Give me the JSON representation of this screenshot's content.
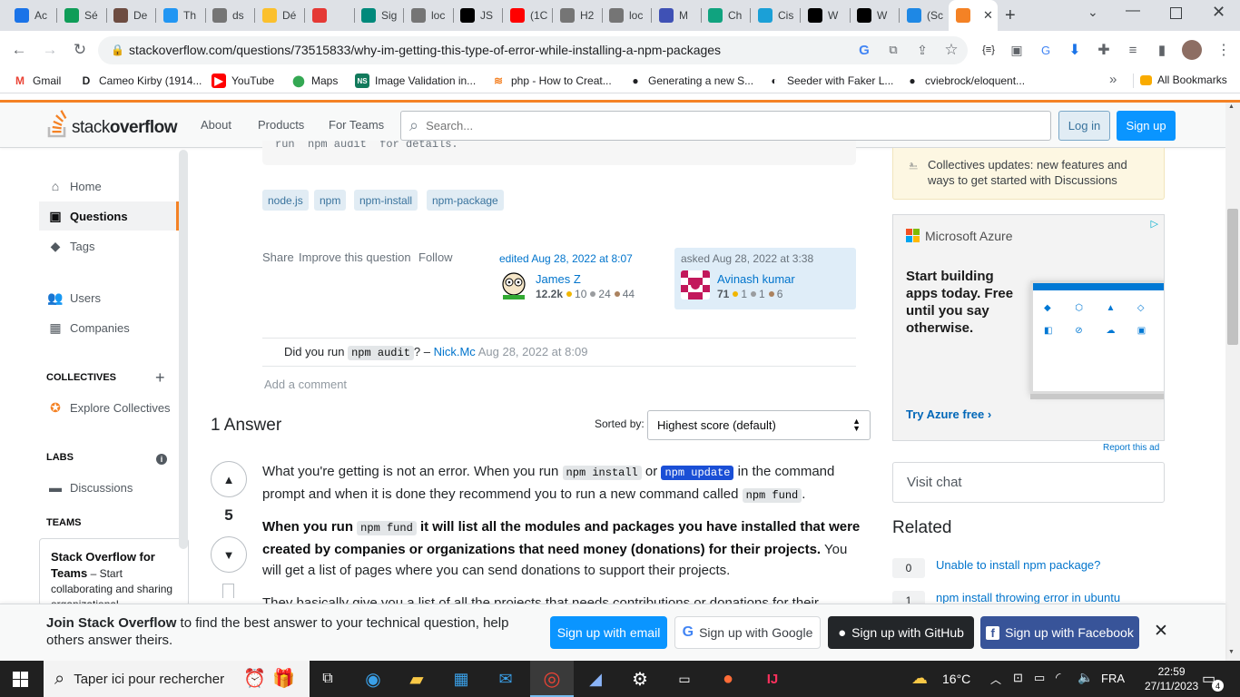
{
  "browser": {
    "tabs": [
      {
        "label": "Ac",
        "color": "#1a73e8"
      },
      {
        "label": "Sé",
        "color": "#0f9d58"
      },
      {
        "label": "De",
        "color": "#6d4c41"
      },
      {
        "label": "Th",
        "color": "#2196f3"
      },
      {
        "label": "ds",
        "color": "#757575"
      },
      {
        "label": "Dé",
        "color": "#fbc02d"
      },
      {
        "label": "",
        "color": "#e53935"
      },
      {
        "label": "Sig",
        "color": "#00897b"
      },
      {
        "label": "loc",
        "color": "#757575"
      },
      {
        "label": "JS",
        "color": "#000000"
      },
      {
        "label": "(1C",
        "color": "#ff0000"
      },
      {
        "label": "H2",
        "color": "#757575"
      },
      {
        "label": "loc",
        "color": "#757575"
      },
      {
        "label": "M",
        "color": "#3f51b5"
      },
      {
        "label": "Ch",
        "color": "#10a37f"
      },
      {
        "label": "Cis",
        "color": "#1ba0d7"
      },
      {
        "label": "W",
        "color": "#000000"
      },
      {
        "label": "W",
        "color": "#000000"
      },
      {
        "label": "(Sc",
        "color": "#1e88e5"
      },
      {
        "label": "",
        "color": "#f48225",
        "active": true
      }
    ],
    "url": "stackoverflow.com/questions/73515833/why-im-getting-this-type-of-error-while-installing-a-npm-packages",
    "bookmarks": [
      "Gmail",
      "Cameo Kirby (1914...",
      "YouTube",
      "Maps",
      "Image Validation in...",
      "php - How to Creat...",
      "Generating a new S...",
      "Seeder with Faker L...",
      "cviebrock/eloquent..."
    ],
    "all_bookmarks": "All Bookmarks"
  },
  "header": {
    "logo_a": "stack",
    "logo_b": "overflow",
    "nav": [
      "About",
      "Products",
      "For Teams"
    ],
    "search_placeholder": "Search...",
    "login": "Log in",
    "signup": "Sign up"
  },
  "sidebar": {
    "home": "Home",
    "questions": "Questions",
    "tags": "Tags",
    "users": "Users",
    "companies": "Companies",
    "collectives_head": "COLLECTIVES",
    "explore": "Explore Collectives",
    "labs_head": "LABS",
    "discussions": "Discussions",
    "teams_head": "TEAMS",
    "teams_title": "Stack Overflow for Teams",
    "teams_dash": " – Start collaborating and sharing organizational"
  },
  "question": {
    "code_tail": "run `npm audit` for details.",
    "tags": [
      "node.js",
      "npm",
      "npm-install",
      "npm-package"
    ],
    "actions": [
      "Share",
      "Improve this question",
      "Follow"
    ],
    "edited": {
      "label": "edited Aug 28, 2022 at 8:07",
      "user": "James Z",
      "rep": "12.2k",
      "gold": "10",
      "silver": "24",
      "bronze": "44"
    },
    "asked": {
      "label": "asked Aug 28, 2022 at 3:38",
      "user": "Avinash kumar",
      "rep": "71",
      "gold": "1",
      "silver": "1",
      "bronze": "6"
    },
    "comment": {
      "pre": "Did you run ",
      "code": "npm audit",
      "post": "? – ",
      "user": "Nick.Mc",
      "date": "Aug 28, 2022 at 8:09"
    },
    "add_comment": "Add a comment"
  },
  "answers": {
    "count_label": "1 Answer",
    "sorted_by": "Sorted by:",
    "sort_value": "Highest score (default)",
    "score": "5",
    "p1_a": "What you're getting is not an error. When you run ",
    "p1_code1": "npm install",
    "p1_b": " or ",
    "p1_code2": "npm update",
    "p1_c": " in the command prompt and when it is done they recommend you to run a new command called ",
    "p1_code3": "npm fund",
    "p1_d": ".",
    "p2_bold_a": "When you run ",
    "p2_code": "npm fund",
    "p2_bold_b": " it will list all the modules and packages you have installed that were created by companies or organizations that need money (donations) for their projects.",
    "p2_rest": " You will get a list of pages where you can send donations to support their projects.",
    "p3": "They basically give you a list of all the projects that needs contributions or donations for their"
  },
  "right": {
    "collectives_update": "Collectives updates: new features and ways to get started with Discussions",
    "ad_brand": "Microsoft Azure",
    "ad_text": "Start building apps today. Free until you say otherwise.",
    "ad_cta": "Try Azure free",
    "report_ad": "Report this ad",
    "visit_chat": "Visit chat",
    "related_head": "Related",
    "related": [
      {
        "score": "0",
        "title": "Unable to install npm package?"
      },
      {
        "score": "1",
        "title": "npm install throwing error in ubuntu"
      }
    ]
  },
  "banner": {
    "bold": "Join Stack Overflow",
    "text": " to find the best answer to your technical question, help others answer theirs.",
    "email": "Sign up with email",
    "google": "Sign up with Google",
    "github": "Sign up with GitHub",
    "facebook": "Sign up with Facebook"
  },
  "taskbar": {
    "search": "Taper ici pour rechercher",
    "temp": "16°C",
    "lang": "FRA",
    "time": "22:59",
    "date": "27/11/2023",
    "notif": "4"
  }
}
